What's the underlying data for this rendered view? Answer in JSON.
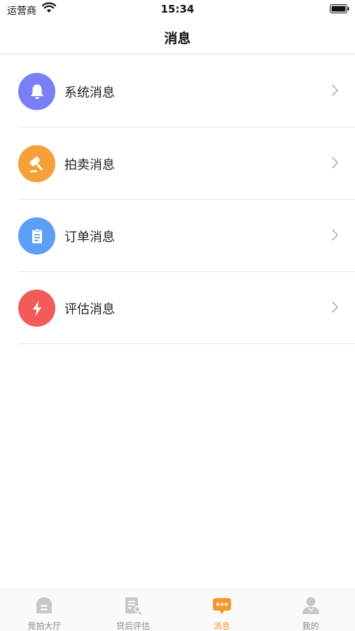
{
  "status_bar": {
    "carrier": "运营商",
    "time": "15:34"
  },
  "nav": {
    "title": "消息"
  },
  "colors": {
    "system": "#7b7ff5",
    "auction": "#f6a03a",
    "order": "#5b9ff7",
    "evaluation": "#f35a5a",
    "tab_active": "#f39a2c",
    "tab_inactive": "#c8c8c8"
  },
  "messages": [
    {
      "label": "系统消息",
      "icon": "bell-icon"
    },
    {
      "label": "拍卖消息",
      "icon": "gavel-icon"
    },
    {
      "label": "订单消息",
      "icon": "clipboard-icon"
    },
    {
      "label": "评估消息",
      "icon": "lightning-icon"
    }
  ],
  "tabs": [
    {
      "label": "竞拍大厅",
      "icon": "auction-hall-icon",
      "active": false
    },
    {
      "label": "贷后评估",
      "icon": "document-search-icon",
      "active": false
    },
    {
      "label": "消息",
      "icon": "chat-bubble-icon",
      "active": true
    },
    {
      "label": "我的",
      "icon": "person-icon",
      "active": false
    }
  ]
}
